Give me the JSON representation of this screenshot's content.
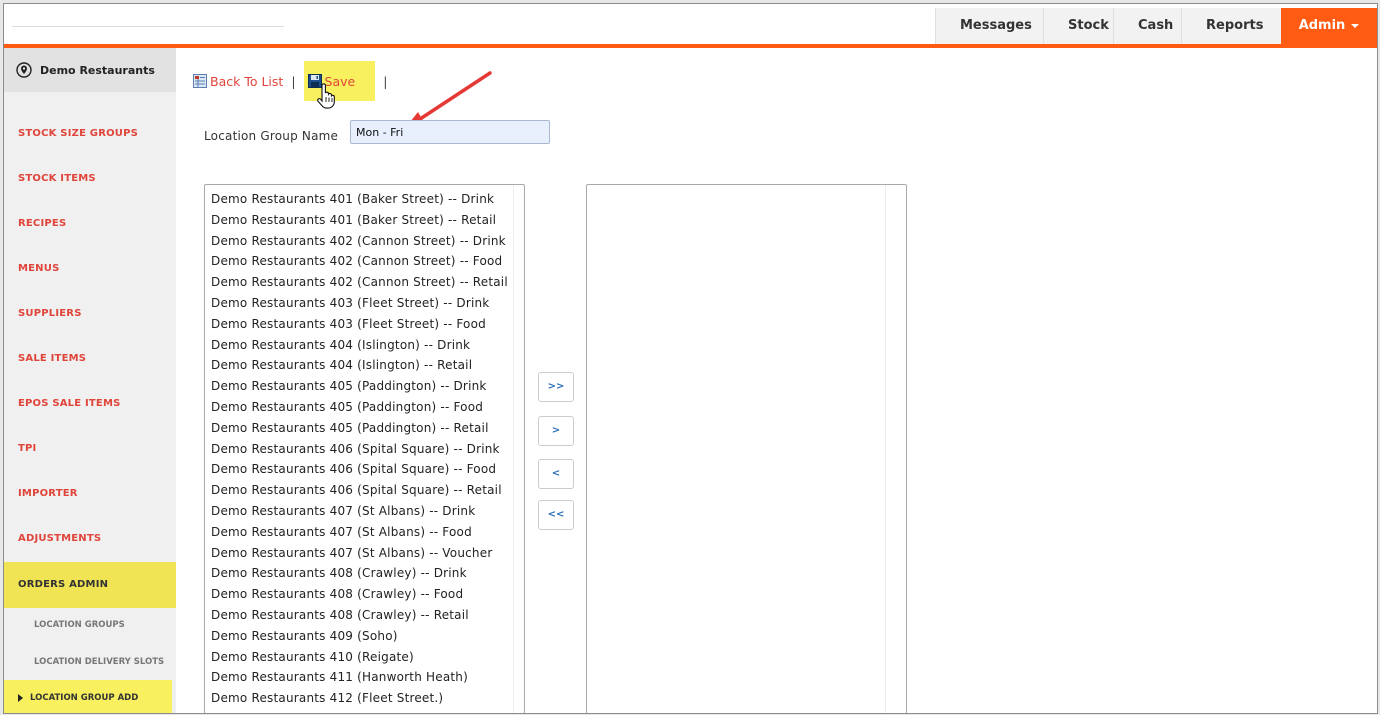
{
  "nav": {
    "items": [
      "Messages",
      "Stock",
      "Cash",
      "Reports"
    ],
    "admin_label": "Admin"
  },
  "sidebar": {
    "location": "Demo Restaurants",
    "items": [
      "STOCK SIZE GROUPS",
      "STOCK ITEMS",
      "RECIPES",
      "MENUS",
      "SUPPLIERS",
      "SALE ITEMS",
      "EPOS SALE ITEMS",
      "TPI",
      "IMPORTER",
      "ADJUSTMENTS",
      "ORDERS ADMIN"
    ],
    "sub_items": [
      "LOCATION GROUPS",
      "LOCATION DELIVERY SLOTS",
      "LOCATION GROUP ADD"
    ]
  },
  "toolbar": {
    "back_label": "Back To List",
    "save_label": "Save",
    "separator": "|"
  },
  "form": {
    "label": "Location Group Name",
    "value": "Mon - Fri"
  },
  "available_locations": [
    "Demo Restaurants 401 (Baker Street) -- Drink",
    "Demo Restaurants 401 (Baker Street) -- Retail",
    "Demo Restaurants 402 (Cannon Street) -- Drink",
    "Demo Restaurants 402 (Cannon Street) -- Food",
    "Demo Restaurants 402 (Cannon Street) -- Retail",
    "Demo Restaurants 403 (Fleet Street) -- Drink",
    "Demo Restaurants 403 (Fleet Street) -- Food",
    "Demo Restaurants 404 (Islington) -- Drink",
    "Demo Restaurants 404 (Islington) -- Retail",
    "Demo Restaurants 405 (Paddington) -- Drink",
    "Demo Restaurants 405 (Paddington) -- Food",
    "Demo Restaurants 405 (Paddington) -- Retail",
    "Demo Restaurants 406 (Spital Square) -- Drink",
    "Demo Restaurants 406 (Spital Square) -- Food",
    "Demo Restaurants 406 (Spital Square) -- Retail",
    "Demo Restaurants 407 (St Albans) -- Drink",
    "Demo Restaurants 407 (St Albans) -- Food",
    "Demo Restaurants 407 (St Albans) -- Voucher",
    "Demo Restaurants 408 (Crawley) -- Drink",
    "Demo Restaurants 408 (Crawley) -- Food",
    "Demo Restaurants 408 (Crawley) -- Retail",
    "Demo Restaurants 409 (Soho)",
    "Demo Restaurants 410 (Reigate)",
    "Demo Restaurants 411 (Hanworth Heath)",
    "Demo Restaurants 412 (Fleet Street.)"
  ],
  "selected_locations": [],
  "transfer_buttons": {
    "add_all": ">>",
    "add": ">",
    "remove": "<",
    "remove_all": "<<"
  },
  "colors": {
    "accent": "#ff5b13",
    "link": "#e0453b",
    "highlight": "#f8f05e"
  }
}
